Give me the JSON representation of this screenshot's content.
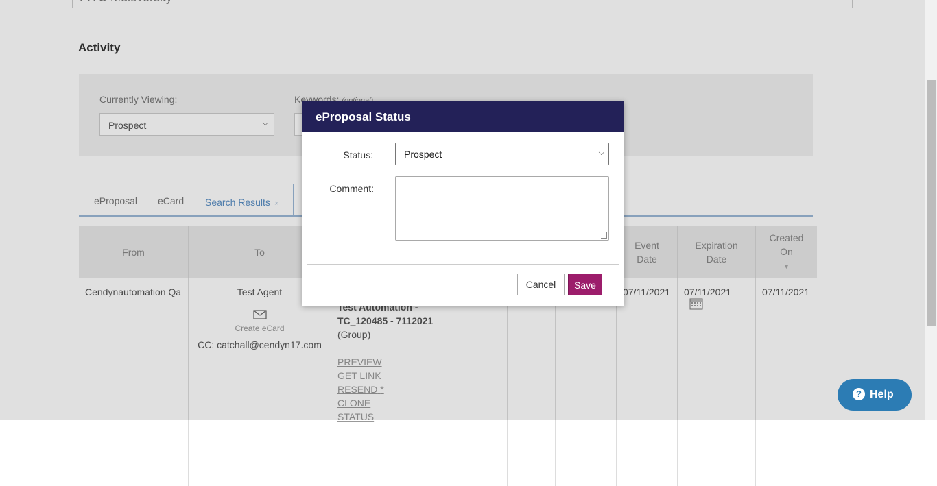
{
  "top_field_value": "FITC Multiversity",
  "activity_title": "Activity",
  "filters": {
    "currently_viewing_label": "Currently Viewing:",
    "currently_viewing_value": "Prospect",
    "keywords_label": "Keywords:",
    "keywords_optional": "(optional)"
  },
  "tabs": [
    {
      "label": "eProposal"
    },
    {
      "label": "eCard"
    },
    {
      "label": "Search Results",
      "close": "×"
    }
  ],
  "table": {
    "headers": {
      "from": "From",
      "to": "To",
      "event_date_1": "Event",
      "event_date_2": "Date",
      "expiration_1": "Expiration",
      "expiration_2": "Date",
      "created_1": "Created",
      "created_2": "On"
    },
    "row": {
      "from": "Cendynautomation Qa",
      "to": "Test Agent",
      "create_ecard": "Create eCard",
      "cc": "CC:  catchall@cendyn17.com",
      "proposal_name_1": "Test Automation -",
      "proposal_name_2": "TC_120485 - 7112021",
      "proposal_type": "(Group)",
      "links": [
        "PREVIEW",
        "GET LINK",
        "RESEND",
        "CLONE",
        "STATUS"
      ],
      "resend_marker": "*",
      "event_date": "07/11/2021",
      "expiration_date": "07/11/2021",
      "created_on": "07/11/2021"
    }
  },
  "modal": {
    "title": "eProposal Status",
    "status_label": "Status:",
    "status_value": "Prospect",
    "comment_label": "Comment:",
    "comment_value": "",
    "cancel_label": "Cancel",
    "save_label": "Save"
  },
  "help": {
    "label": "Help",
    "icon_glyph": "?"
  },
  "colors": {
    "modal_header": "#232158",
    "save_button": "#9c1d6b",
    "help_button": "#2c7cb4",
    "tab_accent": "#5a8fc4"
  }
}
